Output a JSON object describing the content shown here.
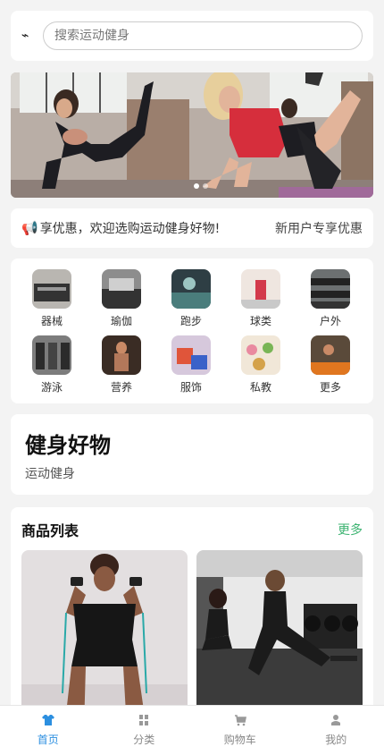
{
  "search": {
    "placeholder": "搜索运动健身",
    "icon": "bolt-icon"
  },
  "banner": {
    "slides": 2,
    "active_slide": 0
  },
  "notice": {
    "icon": "megaphone-icon",
    "text": "享优惠，欢迎选购运动健身好物!",
    "link": "新用户专享优惠"
  },
  "categories": [
    {
      "label": "器械",
      "icon": "equipment-thumb"
    },
    {
      "label": "瑜伽",
      "icon": "yoga-thumb"
    },
    {
      "label": "跑步",
      "icon": "running-thumb"
    },
    {
      "label": "球类",
      "icon": "ball-thumb"
    },
    {
      "label": "户外",
      "icon": "outdoor-thumb"
    },
    {
      "label": "游泳",
      "icon": "swimming-thumb"
    },
    {
      "label": "营养",
      "icon": "nutrition-thumb"
    },
    {
      "label": "服饰",
      "icon": "apparel-thumb"
    },
    {
      "label": "私教",
      "icon": "trainer-thumb"
    },
    {
      "label": "更多",
      "icon": "more-thumb"
    }
  ],
  "brand": {
    "title": "健身好物",
    "subtitle": "运动健身"
  },
  "products": {
    "title": "商品列表",
    "more": "更多"
  },
  "tabbar": {
    "tabs": [
      {
        "label": "首页",
        "icon": "shirt-icon",
        "active": true
      },
      {
        "label": "分类",
        "icon": "grid-icon",
        "active": false
      },
      {
        "label": "购物车",
        "icon": "cart-icon",
        "active": false
      },
      {
        "label": "我的",
        "icon": "user-icon",
        "active": false
      }
    ]
  },
  "colors": {
    "accent": "#2c8fe0",
    "more_link": "#3cb371",
    "background": "#f3f3f3"
  }
}
